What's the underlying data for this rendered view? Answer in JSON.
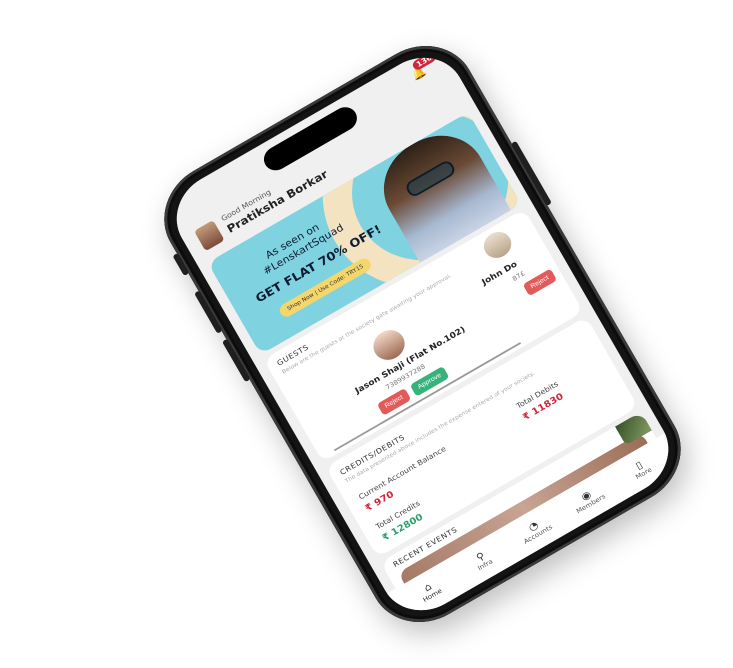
{
  "notifications": {
    "icon": "bell-icon",
    "count": "136"
  },
  "header": {
    "greeting": "Good Morning",
    "user_name": "Pratiksha Borkar"
  },
  "banner": {
    "line1": "As seen on",
    "line2": "#LenskartSquad",
    "headline": "GET FLAT 70% OFF!",
    "cta": "Shop Now | Use Code: TRY15"
  },
  "guests": {
    "title": "GUESTS",
    "subtitle": "Below are the guests at the society gate awaiting your approval.",
    "items": [
      {
        "name": "Jason Shaji (Flat No.102)",
        "phone": "7389937288",
        "reject": "Reject",
        "approve": "Approve"
      },
      {
        "name": "John Do",
        "phone": "87£",
        "reject": "Reject"
      }
    ]
  },
  "credits": {
    "title": "CREDITS/DEBITS",
    "subtitle": "The data presented above includes the expense entered of your society.",
    "current_label": "Current Account Balance",
    "current_value": "₹ 970",
    "debits_label": "Total Debits",
    "debits_value": "₹ 11830",
    "credits_label": "Total Credits",
    "credits_value": "₹ 12800"
  },
  "events": {
    "title": "RECENT EVENTS"
  },
  "nav": [
    {
      "label": "Home",
      "icon": "home-icon",
      "glyph": "⌂"
    },
    {
      "label": "Infra",
      "icon": "network-icon",
      "glyph": "⚲"
    },
    {
      "label": "Accounts",
      "icon": "accounts-icon",
      "glyph": "◔"
    },
    {
      "label": "Members",
      "icon": "members-icon",
      "glyph": "◉"
    },
    {
      "label": "More",
      "icon": "more-icon",
      "glyph": "▯"
    }
  ],
  "colors": {
    "debit": "#d0253c",
    "credit": "#2e9e6a",
    "reject": "#e25a5a",
    "approve": "#38b27a",
    "banner": "#7fd3e0"
  }
}
